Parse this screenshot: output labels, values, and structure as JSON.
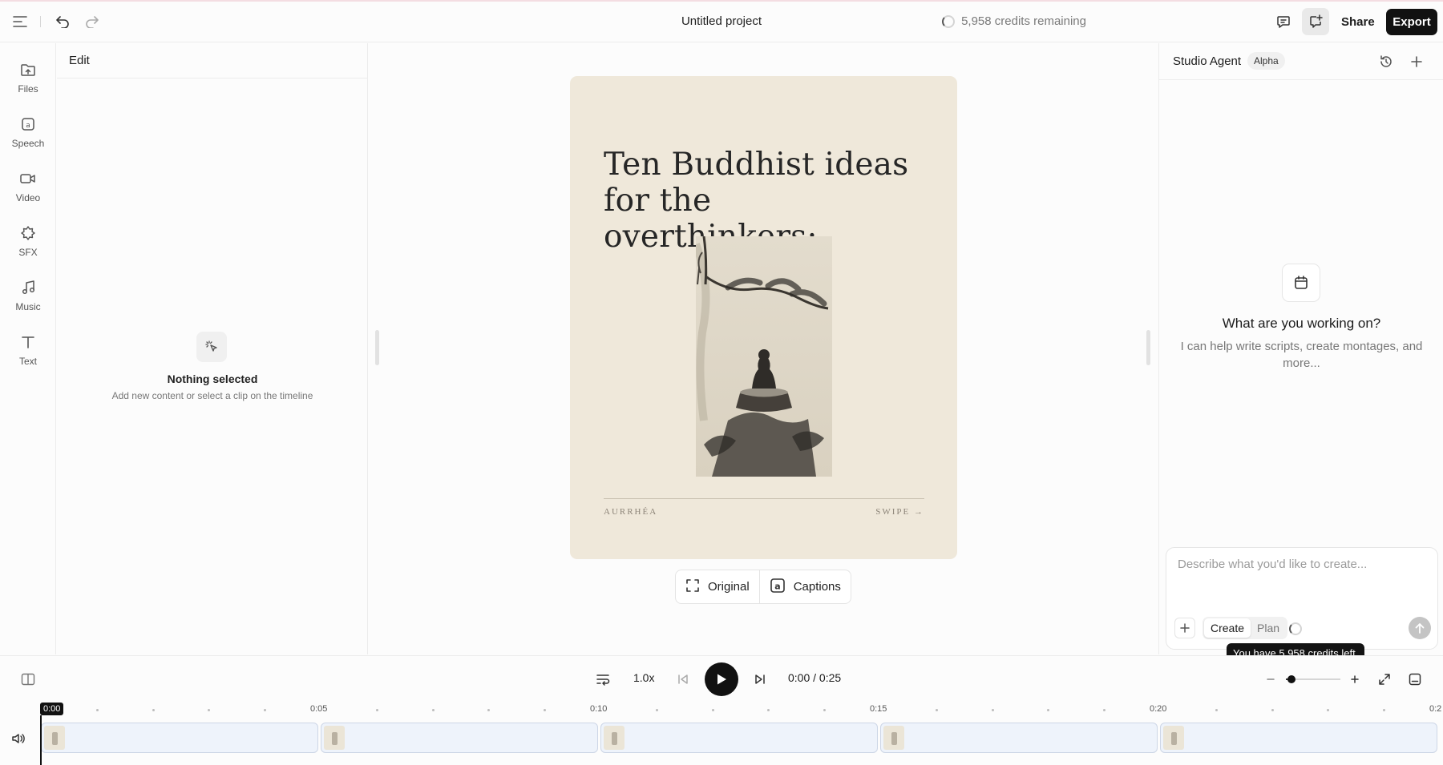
{
  "header": {
    "project_title": "Untitled project",
    "credits_text": "5,958 credits remaining",
    "share_label": "Share",
    "export_label": "Export",
    "icons": [
      "menu-icon",
      "undo-icon",
      "redo-icon",
      "comment-icon",
      "agent-panel-icon"
    ]
  },
  "rail": {
    "items": [
      {
        "label": "Files",
        "icon": "upload-folder-icon"
      },
      {
        "label": "Speech",
        "icon": "speech-icon"
      },
      {
        "label": "Video",
        "icon": "video-icon"
      },
      {
        "label": "SFX",
        "icon": "sfx-icon"
      },
      {
        "label": "Music",
        "icon": "music-icon"
      },
      {
        "label": "Text",
        "icon": "text-icon"
      }
    ]
  },
  "edit_panel": {
    "title": "Edit",
    "empty_title": "Nothing selected",
    "empty_subtitle": "Add new content or select a clip on the timeline"
  },
  "canvas": {
    "title_line1": "Ten Buddhist ideas",
    "title_line2": "for the overthinkers:",
    "footer_left": "AURRHÉA",
    "footer_right": "SWIPE →",
    "background": "#efe8da"
  },
  "view_toggle": {
    "original_label": "Original",
    "captions_label": "Captions"
  },
  "agent": {
    "title": "Studio Agent",
    "badge": "Alpha",
    "question": "What are you working on?",
    "subtitle": "I can help write scripts, create montages, and more...",
    "input_placeholder": "Describe what you'd like to create...",
    "modes": [
      "Create",
      "Plan"
    ],
    "active_mode": "Create",
    "tooltip": "You have 5,958 credits left."
  },
  "transport": {
    "speed": "1.0x",
    "current_time": "0:00",
    "separator": "/",
    "duration": "0:25",
    "zoom_level": 0.08
  },
  "timeline": {
    "playhead_label": "0:00",
    "ruler_labels": [
      "0:05",
      "0:10",
      "0:15",
      "0:20",
      "0:2"
    ],
    "clip_count": 5
  }
}
